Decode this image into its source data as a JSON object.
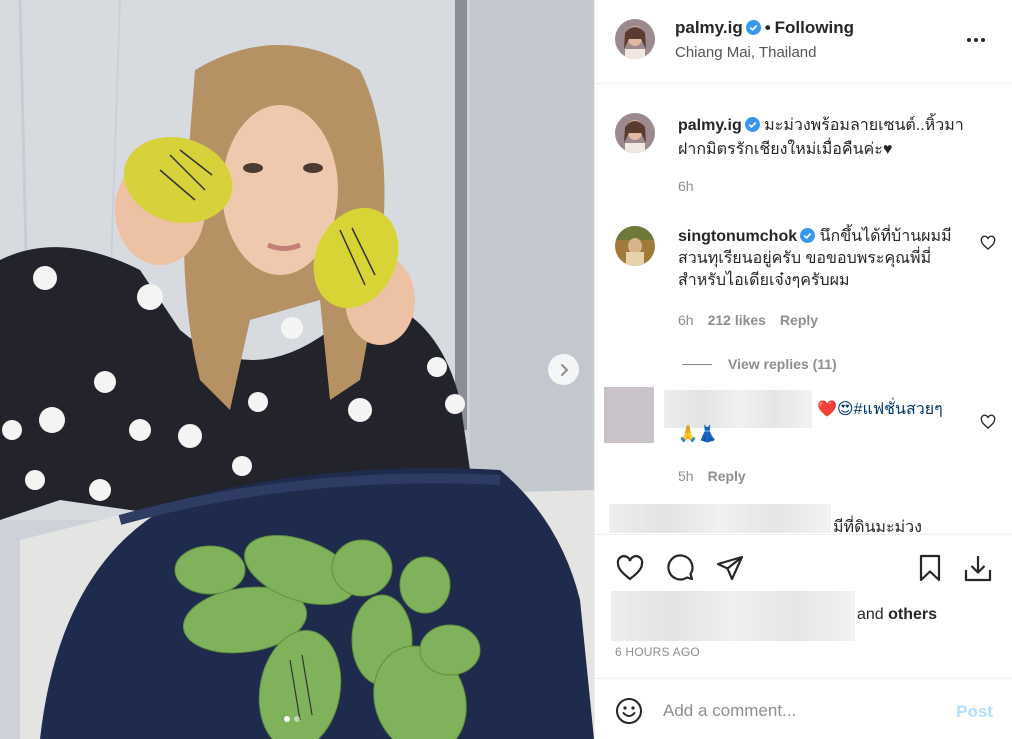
{
  "post": {
    "username": "palmy.ig",
    "follow_separator": "•",
    "follow_status": "Following",
    "location": "Chiang Mai, Thailand",
    "more_icon": "more-options-icon",
    "carousel": {
      "next_icon": "chevron-right-icon",
      "slide_count": 2,
      "active_slide": 1
    }
  },
  "caption": {
    "username": "palmy.ig",
    "text": "มะม่วงพร้อมลายเซนต์..หิ้วมาฝากมิตรรักเชียงใหม่เมื่อคืนค่ะ♥",
    "time": "6h"
  },
  "comments": [
    {
      "username": "singtonumchok",
      "verified": true,
      "text": "นึกขึ้นได้ที่บ้านผมมีสวนทุเรียนอยู่ครับ ขอขอบพระคุณพี่มี่ สำหรับไอเดียเจ๋งๆครับผม",
      "time": "6h",
      "likes": "212 likes",
      "reply": "Reply",
      "view_replies": "View replies (11)"
    },
    {
      "username": "",
      "text_line1": "❤️😍#แฟชั่นสวยๆ",
      "text_line2": "🙏👗",
      "time": "5h",
      "reply": "Reply"
    },
    {
      "text_partial": "มีที่ดินมะม่วง"
    }
  ],
  "actions": {
    "like_icon": "heart-outline-icon",
    "comment_icon": "speech-bubble-icon",
    "share_icon": "paper-plane-icon",
    "save_icon": "bookmark-icon",
    "download_icon": "download-icon",
    "likes_suffix_and": "and",
    "likes_suffix_others": "others",
    "timestamp": "6 HOURS AGO"
  },
  "add_comment": {
    "emoji_icon": "smiley-icon",
    "placeholder": "Add a comment...",
    "post_label": "Post",
    "post_color": "#b2dffc"
  },
  "colors": {
    "verified": "#3897f0",
    "text_primary": "#262626",
    "text_secondary": "#8e8e8e",
    "hashtag": "#00376b",
    "border": "#efefef"
  }
}
